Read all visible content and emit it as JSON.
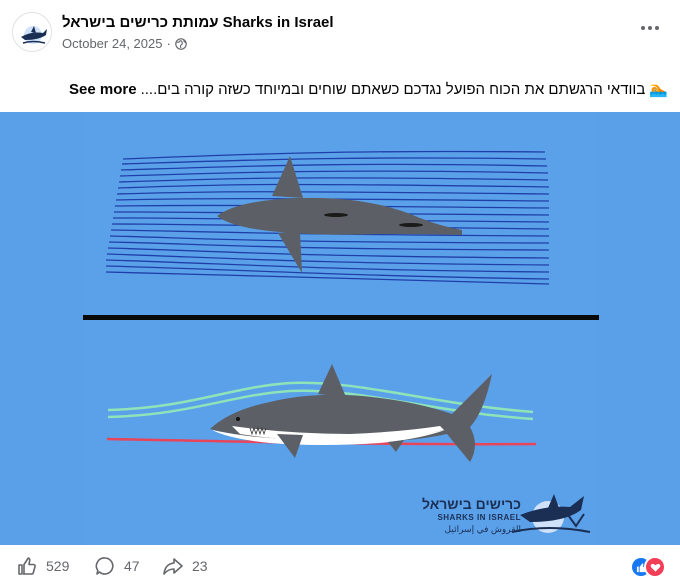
{
  "post": {
    "page_name": "עמותת כרישים בישראל Sharks in Israel",
    "date": "October 24, 2025",
    "meta_separator": "·",
    "caption_emoji": "🏊",
    "caption_text": "בוודאי הרגשתם את הכוח הפועל נגדכם כשאתם שוחים ובמיוחד כשזה קורה בים....",
    "see_more": "See more"
  },
  "image": {
    "logo_hebrew": "כרישים בישראל",
    "logo_english": "SHARKS IN ISRAEL",
    "logo_arabic": "القروش في إسرائيل",
    "colors": {
      "background": "#5ba1ea",
      "flow_lines": "#1f3fa8",
      "shark_body": "#5c6066",
      "green_line": "#8fe3b8",
      "red_line": "#e8445a"
    }
  },
  "footer": {
    "likes": "529",
    "comments": "47",
    "shares": "23"
  },
  "icons": {
    "globe": "globe-icon",
    "more": "more-icon",
    "like": "like-icon",
    "comment": "comment-icon",
    "share": "share-icon"
  }
}
